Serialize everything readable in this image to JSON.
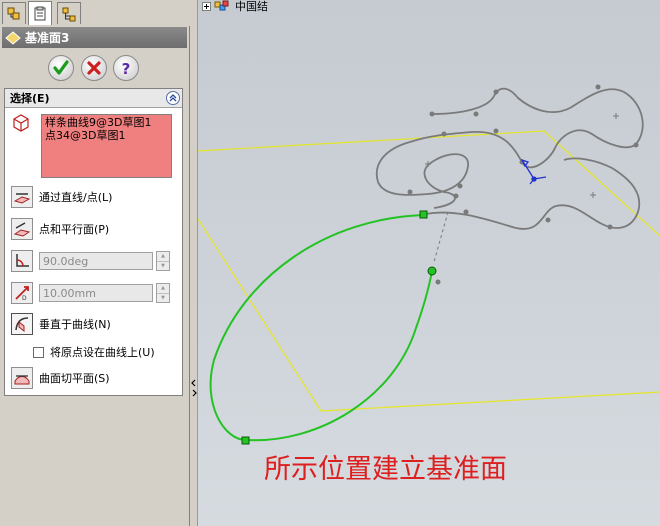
{
  "panel": {
    "tabs": [
      {
        "name": "feature-manager-tab-icon"
      },
      {
        "name": "property-manager-tab-icon"
      },
      {
        "name": "configuration-manager-tab-icon"
      }
    ],
    "title": "基准面3",
    "buttons": {
      "ok": "ok-icon",
      "cancel": "cancel-icon",
      "help": "help-icon"
    },
    "selection": {
      "header": "选择(E)",
      "items": [
        "样条曲线9@3D草图1",
        "点34@3D草图1"
      ]
    },
    "options": {
      "through_line_point": "通过直线/点(L)",
      "point_parallel_plane": "点和平行面(P)",
      "angle_value": "90.0deg",
      "distance_value": "10.00mm",
      "normal_to_curve": "垂直于曲线(N)",
      "origin_on_curve": "将原点设在曲线上(U)",
      "origin_on_curve_checked": false,
      "tangent_to_surface": "曲面切平面(S)"
    }
  },
  "graphics": {
    "tree_node": "中国结",
    "caption": "所示位置建立基准面",
    "colors": {
      "plane_outline": "#e6e627",
      "selected_curve": "#22c322",
      "reference_curve": "#7a7a7a",
      "caption": "#dd1f1f",
      "triad": "#2233cc"
    }
  }
}
